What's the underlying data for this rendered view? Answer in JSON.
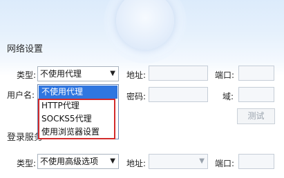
{
  "network": {
    "title": "网络设置",
    "type_label": "类型:",
    "type_value": "不使用代理",
    "address_label": "地址:",
    "port_label": "端口:",
    "username_label": "用户名:",
    "password_label": "密码:",
    "domain_label": "域:",
    "test_button": "测试"
  },
  "proxy_dropdown": {
    "options": [
      "不使用代理",
      "HTTP代理",
      "SOCKS5代理",
      "使用浏览器设置"
    ],
    "selected_index": 0
  },
  "login_server": {
    "title": "登录服务",
    "type_label": "类型:",
    "type_value": "不使用高级选项",
    "address_label": "地址:",
    "port_label": "端口:"
  },
  "colors": {
    "selection": "#2f76e0",
    "highlight_border": "#d32a2a"
  },
  "icons": {
    "dropdown_arrow": "▼"
  }
}
